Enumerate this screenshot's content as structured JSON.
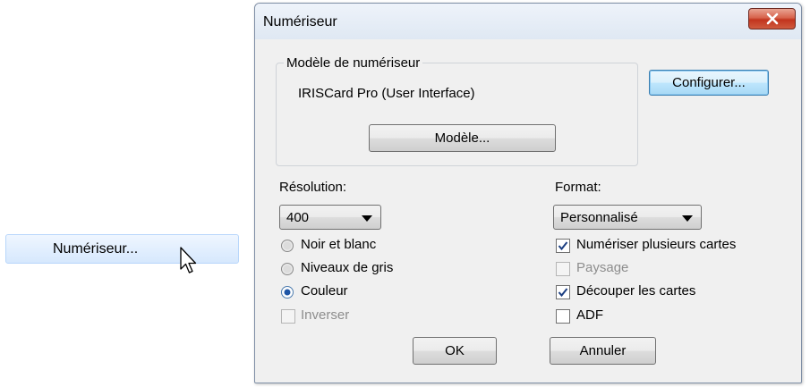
{
  "menu": {
    "item_label": "Numériseur..."
  },
  "dialog": {
    "title": "Numériseur",
    "scanner_group": {
      "legend": "Modèle de numériseur",
      "model_name": "IRISCard Pro (User Interface)",
      "model_button": "Modèle..."
    },
    "configure_button": "Configurer...",
    "resolution": {
      "label": "Résolution:",
      "value": "400"
    },
    "format": {
      "label": "Format:",
      "value": "Personnalisé"
    },
    "color_modes": [
      {
        "label": "Noir et blanc",
        "selected": false
      },
      {
        "label": "Niveaux de gris",
        "selected": false
      },
      {
        "label": "Couleur",
        "selected": true
      }
    ],
    "invert": {
      "label": "Inverser",
      "checked": false,
      "enabled": false
    },
    "options": [
      {
        "label": "Numériser plusieurs cartes",
        "checked": true,
        "enabled": true
      },
      {
        "label": "Paysage",
        "checked": false,
        "enabled": false
      },
      {
        "label": "Découper les cartes",
        "checked": true,
        "enabled": true
      },
      {
        "label": "ADF",
        "checked": false,
        "enabled": true
      }
    ],
    "ok_button": "OK",
    "cancel_button": "Annuler"
  }
}
